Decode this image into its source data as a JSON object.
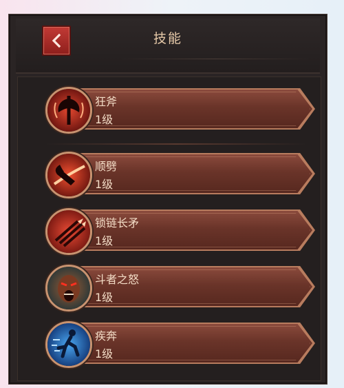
{
  "header": {
    "title": "技能",
    "back_label": "back"
  },
  "skills": [
    {
      "name": "狂斧",
      "level": "1级",
      "icon": "rage-axe-icon",
      "color": "#b3201c"
    },
    {
      "name": "顺劈",
      "level": "1级",
      "icon": "cleave-icon",
      "color": "#a9231b"
    },
    {
      "name": "锁链长矛",
      "level": "1级",
      "icon": "chain-spear-icon",
      "color": "#b52a22"
    },
    {
      "name": "斗者之怒",
      "level": "1级",
      "icon": "fighter-wrath-icon",
      "color": "#5a3a24"
    },
    {
      "name": "疾奔",
      "level": "1级",
      "icon": "sprint-icon",
      "color": "#1a64b8"
    }
  ],
  "colors": {
    "accent": "#c23a35",
    "text": "#f3dcc6",
    "plate": "#6a3429"
  }
}
